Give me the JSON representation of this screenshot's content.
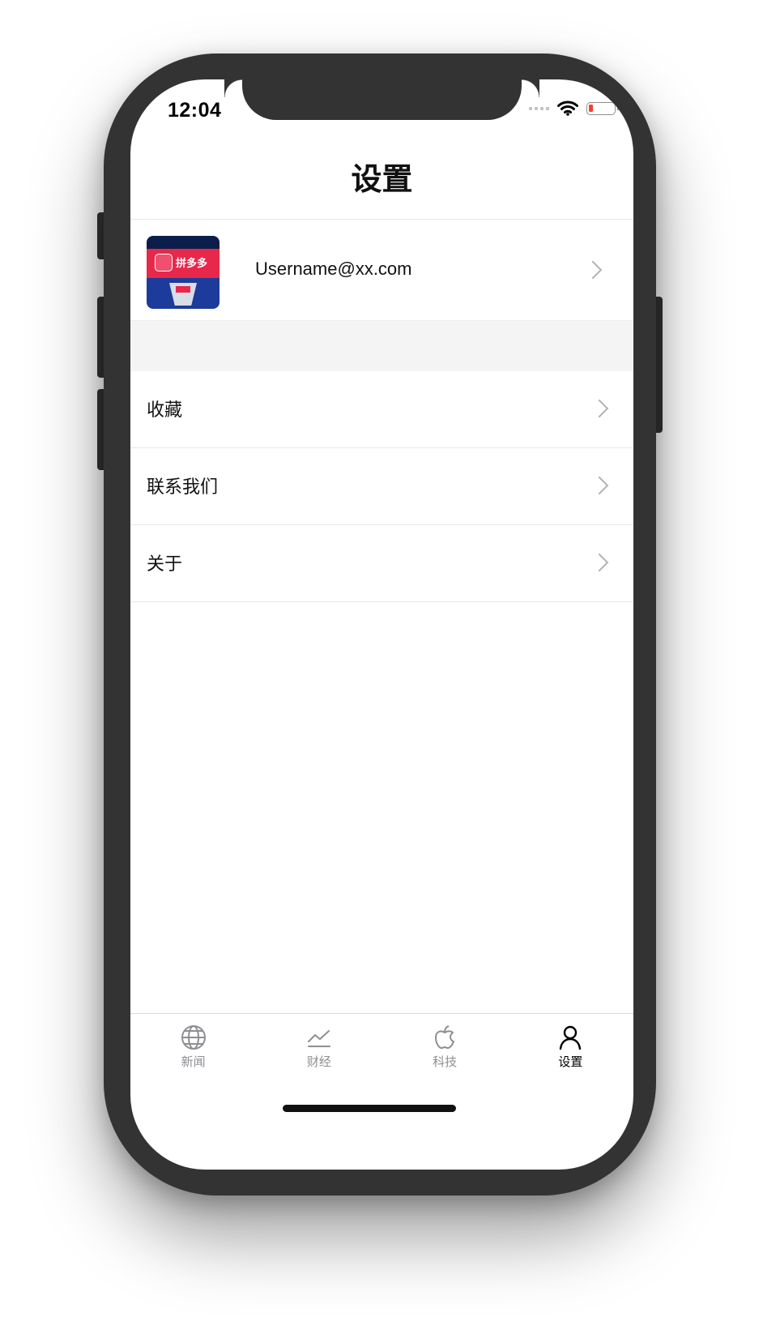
{
  "status_bar": {
    "time": "12:04",
    "battery_level": 0.1,
    "signal_icon": "signal-icon",
    "wifi_icon": "wifi-icon",
    "battery_icon": "battery-icon"
  },
  "navigation": {
    "title": "设置"
  },
  "profile": {
    "email": "Username@xx.com",
    "avatar_text": "拼多多",
    "avatar_icon": "avatar-image"
  },
  "menu": {
    "items": [
      {
        "label": "收藏"
      },
      {
        "label": "联系我们"
      },
      {
        "label": "关于"
      }
    ]
  },
  "tab_bar": {
    "active_index": 3,
    "tabs": [
      {
        "label": "新闻",
        "icon": "globe-icon"
      },
      {
        "label": "财经",
        "icon": "chart-line-icon"
      },
      {
        "label": "科技",
        "icon": "apple-icon"
      },
      {
        "label": "设置",
        "icon": "person-icon"
      }
    ]
  },
  "colors": {
    "frame": "#333333",
    "section_background": "#f4f4f4",
    "chevron": "#b3b3b3",
    "tab_inactive": "#8e8e93",
    "tab_active": "#000000",
    "battery_low": "#ff3b30"
  }
}
